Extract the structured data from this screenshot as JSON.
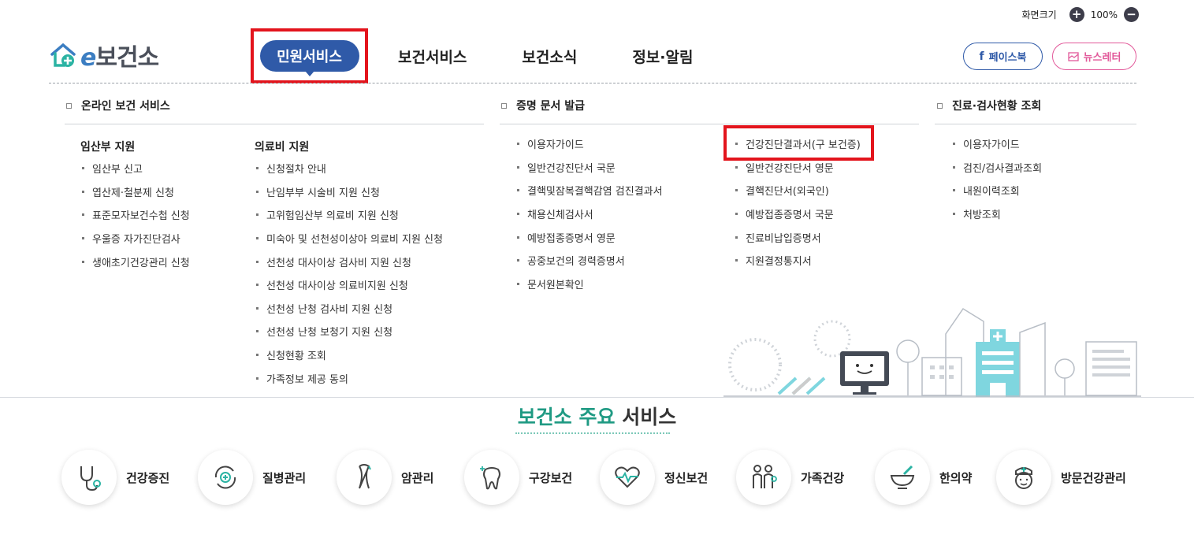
{
  "zoom": {
    "label": "화면크기",
    "value": "100%",
    "plus_glyph": "+",
    "minus_glyph": "−"
  },
  "logo": {
    "e": "e",
    "text": "보건소"
  },
  "gnb": [
    {
      "label": "민원서비스",
      "active": true
    },
    {
      "label": "보건서비스"
    },
    {
      "label": "보건소식"
    },
    {
      "label": "정보·알림"
    }
  ],
  "sns": {
    "facebook": "페이스북",
    "newsletter": "뉴스레터",
    "facebook_color": "#2f5aa8",
    "newsletter_color": "#e2599a"
  },
  "columns": {
    "col1": {
      "title": "온라인 보건 서비스",
      "groups": [
        {
          "title": "임산부 지원",
          "items": [
            "임산부 신고",
            "엽산제·철분제 신청",
            "표준모자보건수첩 신청",
            "우울증 자가진단검사",
            "생애초기건강관리 신청"
          ]
        },
        {
          "title": "의료비 지원",
          "items": [
            "신청절차 안내",
            "난임부부 시술비 지원 신청",
            "고위험임산부 의료비 지원 신청",
            "미숙아 및 선천성이상아 의료비 지원 신청",
            "선천성 대사이상 검사비 지원 신청",
            "선천성 대사이상 의료비지원 신청",
            "선천성 난청 검사비 지원 신청",
            "선천성 난청 보청기 지원 신청",
            "신청현황 조회",
            "가족정보 제공 동의"
          ]
        }
      ]
    },
    "col2": {
      "title": "증명 문서 발급",
      "left": [
        "이용자가이드",
        "일반건강진단서 국문",
        "결핵및잠복결핵감염 검진결과서",
        "채용신체검사서",
        "예방접종증명서 영문",
        "공중보건의 경력증명서",
        "문서원본확인"
      ],
      "right": [
        "건강진단결과서(구 보건증)",
        "일반건강진단서 영문",
        "결핵진단서(외국인)",
        "예방접종증명서 국문",
        "진료비납입증명서",
        "지원결정통지서"
      ]
    },
    "col3": {
      "title": "진료·검사현황 조회",
      "items": [
        "이용자가이드",
        "검진/검사결과조회",
        "내원이력조회",
        "처방조회"
      ]
    }
  },
  "section": {
    "title_accent": "보건소 주요",
    "title_rest": " 서비스",
    "accent_color": "#1f9a83"
  },
  "services": [
    {
      "label": "건강증진",
      "icon": "stethoscope-icon"
    },
    {
      "label": "질병관리",
      "icon": "disease-cycle-icon"
    },
    {
      "label": "암관리",
      "icon": "cancer-ribbon-icon"
    },
    {
      "label": "구강보건",
      "icon": "tooth-icon"
    },
    {
      "label": "정신보건",
      "icon": "heartbeat-icon"
    },
    {
      "label": "가족건강",
      "icon": "family-icon"
    },
    {
      "label": "한의약",
      "icon": "mortar-pestle-icon"
    },
    {
      "label": "방문건강관리",
      "icon": "nurse-icon"
    }
  ]
}
